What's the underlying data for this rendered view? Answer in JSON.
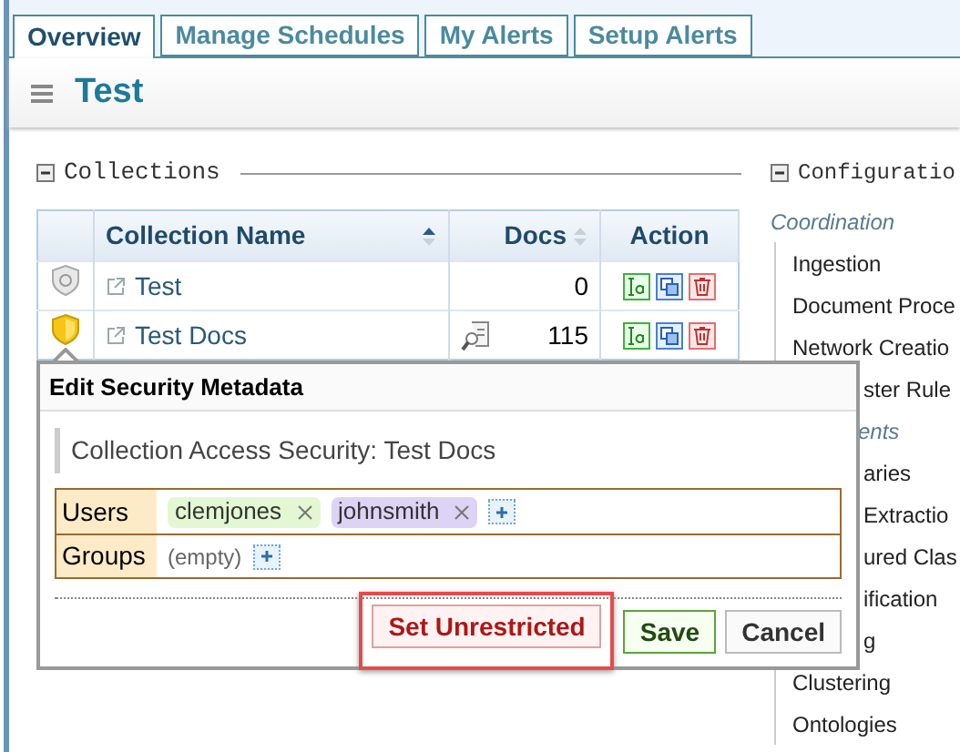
{
  "tabs": [
    {
      "label": "Overview",
      "selected": true
    },
    {
      "label": "Manage Schedules",
      "selected": false
    },
    {
      "label": "My Alerts",
      "selected": false
    },
    {
      "label": "Setup Alerts",
      "selected": false
    }
  ],
  "header": {
    "title": "Test"
  },
  "collections": {
    "title": "Collections",
    "columns": [
      {
        "label": "Collection Name",
        "sortable": true,
        "sorted": true
      },
      {
        "label": "Docs",
        "sortable": true,
        "sorted": false
      },
      {
        "label": "Action",
        "sortable": false
      }
    ],
    "rows": [
      {
        "name": "Test",
        "docs": "0",
        "secured": false,
        "searchable": false
      },
      {
        "name": "Test Docs",
        "docs": "115",
        "secured": true,
        "searchable": true
      }
    ]
  },
  "configuration": {
    "title": "Configuratio",
    "items": [
      {
        "kind": "section",
        "label": "Coordination"
      },
      {
        "kind": "item",
        "label": "Ingestion"
      },
      {
        "kind": "item",
        "label": "Document Proce"
      },
      {
        "kind": "item",
        "label": "Network Creatio"
      },
      {
        "kind": "partial_item",
        "label": "ster Rule"
      },
      {
        "kind": "partial_section",
        "label": "ents"
      },
      {
        "kind": "partial_item",
        "label": "aries"
      },
      {
        "kind": "partial_item",
        "label": "Extractio"
      },
      {
        "kind": "partial_item",
        "label": "ured Clas"
      },
      {
        "kind": "partial_item",
        "label": "ification"
      },
      {
        "kind": "partial_item",
        "label": "g"
      },
      {
        "kind": "item",
        "label": "Clustering"
      },
      {
        "kind": "item",
        "label": "Ontologies"
      }
    ]
  },
  "popup": {
    "title": "Edit Security Metadata",
    "subtitle": "Collection Access Security: Test Docs",
    "fields": [
      {
        "label": "Users",
        "tags": [
          {
            "text": "clemjones",
            "color": "#e2f7d2"
          },
          {
            "text": "johnsmith",
            "color": "#ddd3f5"
          }
        ]
      },
      {
        "label": "Groups",
        "empty_text": "(empty)"
      }
    ],
    "buttons": [
      {
        "label": "Set Unrestricted",
        "kind": "danger",
        "highlighted": true
      },
      {
        "label": "Save",
        "kind": "primary",
        "highlighted": false
      },
      {
        "label": "Cancel",
        "kind": "default",
        "highlighted": false
      }
    ]
  }
}
